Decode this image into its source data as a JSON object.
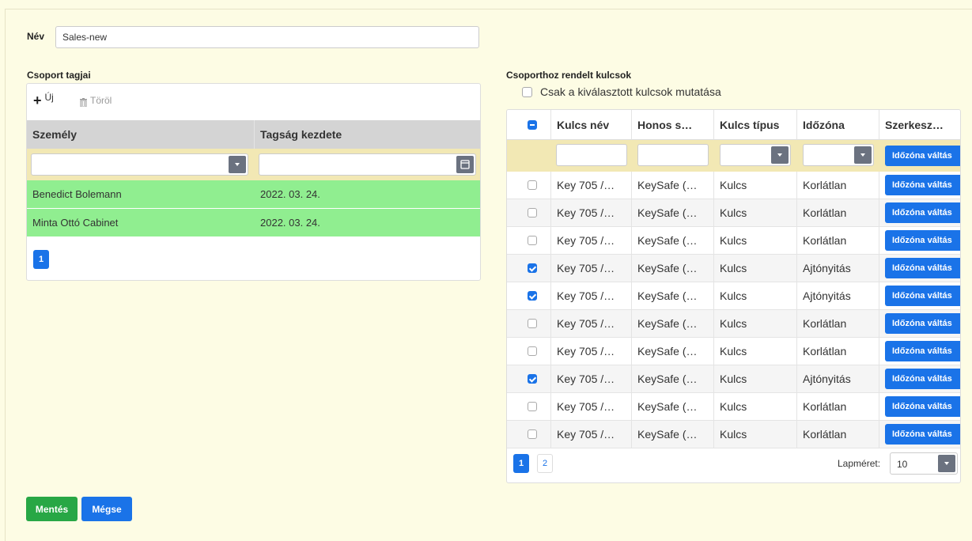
{
  "form": {
    "name_label": "Név",
    "name_value": "Sales-new"
  },
  "members": {
    "title": "Csoport tagjai",
    "toolbar": {
      "new_label": "Új",
      "delete_label": "Töröl"
    },
    "columns": [
      "Személy",
      "Tagság kezdete"
    ],
    "rows": [
      {
        "person": "Benedict Bolemann",
        "start": "2022. 03. 24."
      },
      {
        "person": "Minta Ottó Cabinet",
        "start": "2022. 03. 24."
      }
    ],
    "page": "1"
  },
  "keys": {
    "title": "Csoporthoz rendelt kulcsok",
    "show_selected_label": "Csak a kiválasztott kulcsok mutatása",
    "columns": [
      "Kulcs név",
      "Honos s…",
      "Kulcs típus",
      "Időzóna",
      "Szerkesz…"
    ],
    "filter_button": "Időzóna váltás",
    "rows": [
      {
        "checked": false,
        "name": "Key 705 /…",
        "home": "KeySafe (…",
        "type": "Kulcs",
        "zone": "Korlátlan",
        "action": "Időzóna váltás"
      },
      {
        "checked": false,
        "name": "Key 705 /…",
        "home": "KeySafe (…",
        "type": "Kulcs",
        "zone": "Korlátlan",
        "action": "Időzóna váltás"
      },
      {
        "checked": false,
        "name": "Key 705 /…",
        "home": "KeySafe (…",
        "type": "Kulcs",
        "zone": "Korlátlan",
        "action": "Időzóna váltás"
      },
      {
        "checked": true,
        "name": "Key 705 /…",
        "home": "KeySafe (…",
        "type": "Kulcs",
        "zone": "Ajtónyitás",
        "action": "Időzóna váltás"
      },
      {
        "checked": true,
        "name": "Key 705 /…",
        "home": "KeySafe (…",
        "type": "Kulcs",
        "zone": "Ajtónyitás",
        "action": "Időzóna váltás"
      },
      {
        "checked": false,
        "name": "Key 705 /…",
        "home": "KeySafe (…",
        "type": "Kulcs",
        "zone": "Korlátlan",
        "action": "Időzóna váltás"
      },
      {
        "checked": false,
        "name": "Key 705 /…",
        "home": "KeySafe (…",
        "type": "Kulcs",
        "zone": "Korlátlan",
        "action": "Időzóna váltás"
      },
      {
        "checked": true,
        "name": "Key 705 /…",
        "home": "KeySafe (…",
        "type": "Kulcs",
        "zone": "Ajtónyitás",
        "action": "Időzóna váltás"
      },
      {
        "checked": false,
        "name": "Key 705 /…",
        "home": "KeySafe (…",
        "type": "Kulcs",
        "zone": "Korlátlan",
        "action": "Időzóna váltás"
      },
      {
        "checked": false,
        "name": "Key 705 /…",
        "home": "KeySafe (…",
        "type": "Kulcs",
        "zone": "Korlátlan",
        "action": "Időzóna váltás"
      }
    ],
    "pages": [
      "1",
      "2"
    ],
    "page_size_label": "Lapméret:",
    "page_size_value": "10"
  },
  "actions": {
    "save_label": "Mentés",
    "cancel_label": "Mégse"
  },
  "colors": {
    "primary": "#1a73e8",
    "success": "#28a745",
    "row_selected": "#90ee90",
    "background": "#fdfce4"
  }
}
